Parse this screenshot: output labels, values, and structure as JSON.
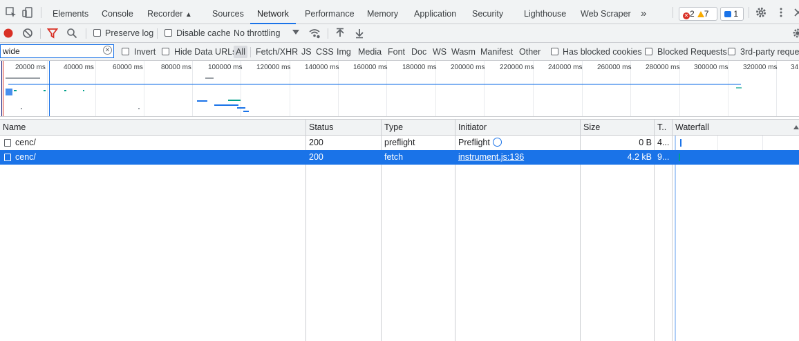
{
  "tabs": [
    {
      "label": "Elements"
    },
    {
      "label": "Console"
    },
    {
      "label": "Recorder"
    },
    {
      "label": "Sources"
    },
    {
      "label": "Network"
    },
    {
      "label": "Performance"
    },
    {
      "label": "Memory"
    },
    {
      "label": "Application"
    },
    {
      "label": "Security"
    },
    {
      "label": "Lighthouse"
    },
    {
      "label": "Web Scraper"
    }
  ],
  "active_tab": "Network",
  "more_tabs": "»",
  "issues": {
    "errors": "2",
    "warnings": "7",
    "messages": "1"
  },
  "toolbar": {
    "preserve_log": "Preserve log",
    "disable_cache": "Disable cache",
    "throttling": "No throttling"
  },
  "filter": {
    "value": "wide",
    "invert": "Invert",
    "hide_data_urls": "Hide Data URLs",
    "types": [
      "All",
      "Fetch/XHR",
      "JS",
      "CSS",
      "Img",
      "Media",
      "Font",
      "Doc",
      "WS",
      "Wasm",
      "Manifest",
      "Other"
    ],
    "selected_type": "All",
    "blocked_cookies": "Has blocked cookies",
    "blocked_requests": "Blocked Requests",
    "third_party": "3rd-party reque"
  },
  "overview_ticks": [
    "20000 ms",
    "40000 ms",
    "60000 ms",
    "80000 ms",
    "100000 ms",
    "120000 ms",
    "140000 ms",
    "160000 ms",
    "180000 ms",
    "200000 ms",
    "220000 ms",
    "240000 ms",
    "260000 ms",
    "280000 ms",
    "300000 ms",
    "320000 ms",
    "34"
  ],
  "table": {
    "columns": [
      "Name",
      "Status",
      "Type",
      "Initiator",
      "Size",
      "T..",
      "Waterfall"
    ],
    "rows": [
      {
        "name": "cenc/",
        "status": "200",
        "type": "preflight",
        "initiator": "Preflight",
        "size": "0 B",
        "time": "4..."
      },
      {
        "name": "cenc/",
        "status": "200",
        "type": "fetch",
        "initiator": "instrument.js:136",
        "size": "4.2 kB",
        "time": "9..."
      }
    ]
  },
  "colors": {
    "accent": "#1a73e8",
    "error": "#d93025",
    "warning": "#f9ab00",
    "record": "#d93025"
  }
}
